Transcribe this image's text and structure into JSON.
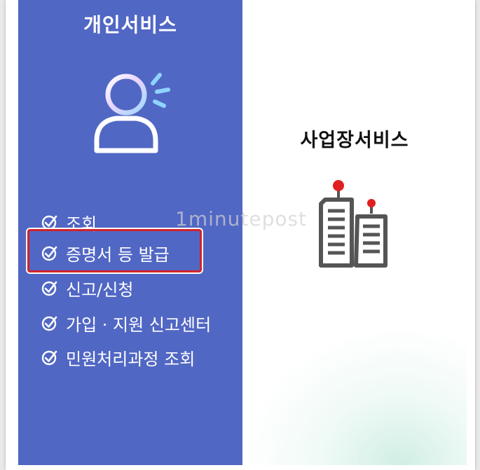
{
  "personal": {
    "title": "개인서비스",
    "menu": [
      {
        "label": "조회"
      },
      {
        "label": "증명서 등 발급"
      },
      {
        "label": "신고/신청"
      },
      {
        "label": "가입 · 지원 신고센터"
      },
      {
        "label": "민원처리과정 조회"
      }
    ],
    "highlighted_item": "증명서 등 발급"
  },
  "business": {
    "title": "사업장서비스"
  },
  "watermark": "1minutepost",
  "icons": {
    "personal": "person-icon",
    "business": "building-icon",
    "menu_check": "check-circle-icon"
  },
  "colors": {
    "panel_blue": "#5167c4",
    "highlight_red": "#d2232a",
    "building_gray": "#555555",
    "antenna_red": "#e02020"
  }
}
